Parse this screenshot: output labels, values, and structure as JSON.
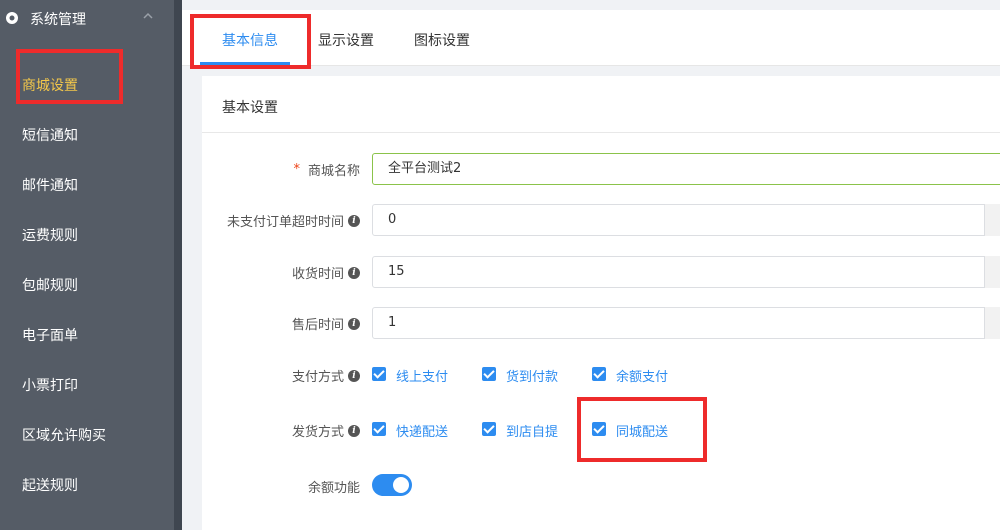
{
  "sidebar": {
    "section_title": "系统管理",
    "items": [
      {
        "label": "商城设置",
        "active": true
      },
      {
        "label": "短信通知"
      },
      {
        "label": "邮件通知"
      },
      {
        "label": "运费规则"
      },
      {
        "label": "包邮规则"
      },
      {
        "label": "电子面单"
      },
      {
        "label": "小票打印"
      },
      {
        "label": "区域允许购买"
      },
      {
        "label": "起送规则"
      }
    ]
  },
  "tabs": [
    {
      "label": "基本信息",
      "active": true
    },
    {
      "label": "显示设置"
    },
    {
      "label": "图标设置"
    }
  ],
  "card": {
    "title": "基本设置"
  },
  "form": {
    "shop_name": {
      "label": "商城名称",
      "value": "全平台测试2"
    },
    "unpaid_timeout": {
      "label": "未支付订单超时时间",
      "value": "0"
    },
    "receive_time": {
      "label": "收货时间",
      "value": "15"
    },
    "after_sale_time": {
      "label": "售后时间",
      "value": "1"
    },
    "payment": {
      "label": "支付方式",
      "options": [
        "线上支付",
        "货到付款",
        "余额支付"
      ]
    },
    "delivery": {
      "label": "发货方式",
      "options": [
        "快递配送",
        "到店自提",
        "同城配送"
      ]
    },
    "balance": {
      "label": "余额功能",
      "enabled": true
    }
  },
  "colors": {
    "accent": "#2d8cf0",
    "highlight": "#ee2b2b",
    "sidebar_active": "#f3c74a"
  }
}
